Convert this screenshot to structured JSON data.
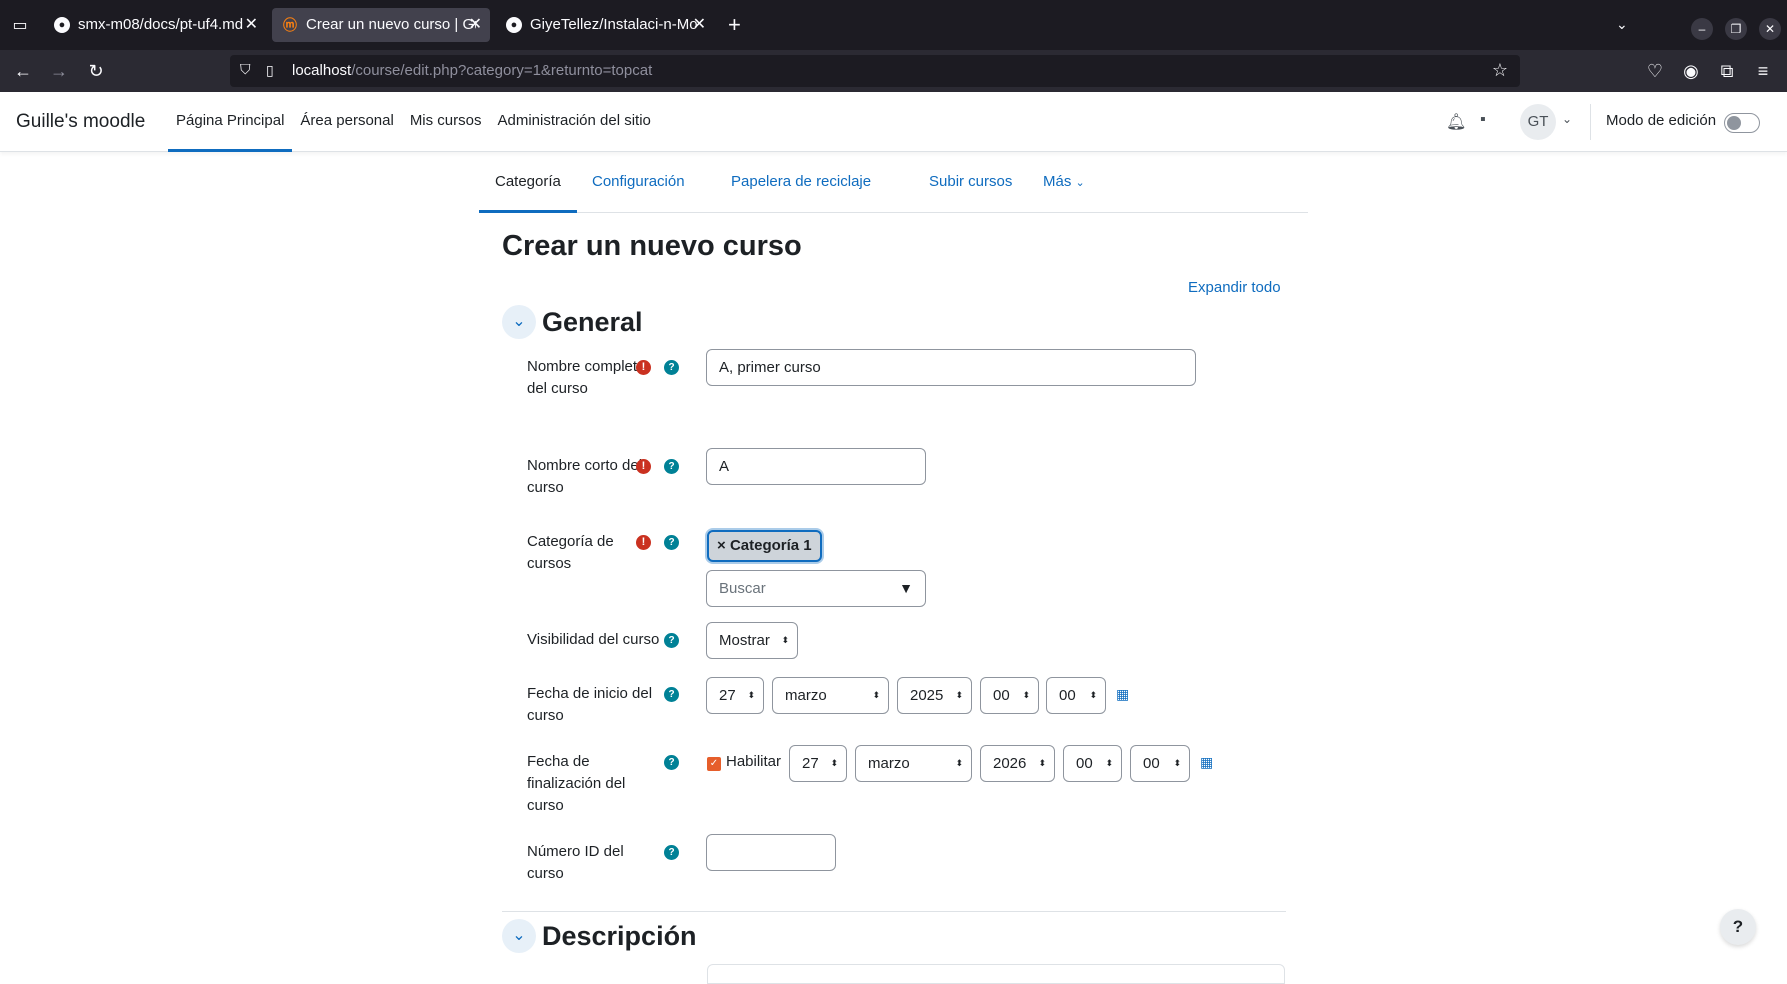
{
  "browser": {
    "tabs": [
      {
        "label": "smx-m08/docs/pt-uf4.md",
        "favicon": "github-icon",
        "active": false
      },
      {
        "label": "Crear un nuevo curso | Gu",
        "favicon": "moodle-icon",
        "active": true
      },
      {
        "label": "GiyeTellez/Instalaci-n-Mo",
        "favicon": "github-icon",
        "active": false
      }
    ],
    "url_host": "localhost",
    "url_path": "/course/edit.php?category=1&returnto=topcat"
  },
  "header": {
    "brand": "Guille's moodle",
    "nav": [
      "Página Principal",
      "Área personal",
      "Mis cursos",
      "Administración del sitio"
    ],
    "avatar_initials": "GT",
    "edit_mode_label": "Modo de edición"
  },
  "secondary_nav": [
    "Categoría",
    "Configuración",
    "Papelera de reciclaje",
    "Subir cursos",
    "Más"
  ],
  "page": {
    "title": "Crear un nuevo curso",
    "expand_all": "Expandir todo"
  },
  "general": {
    "title": "General",
    "fullname": {
      "label": "Nombre completo del curso",
      "value": "A, primer curso"
    },
    "shortname": {
      "label": "Nombre corto del curso",
      "value": "A"
    },
    "category": {
      "label": "Categoría de cursos",
      "tag": "Categoría 1",
      "search_placeholder": "Buscar"
    },
    "visibility": {
      "label": "Visibilidad del curso",
      "value": "Mostrar"
    },
    "startdate": {
      "label": "Fecha de inicio del curso",
      "day": "27",
      "month": "marzo",
      "year": "2025",
      "hour": "00",
      "minute": "00"
    },
    "enddate": {
      "label": "Fecha de finalización del curso",
      "enable_label": "Habilitar",
      "enabled": true,
      "day": "27",
      "month": "marzo",
      "year": "2026",
      "hour": "00",
      "minute": "00"
    },
    "idnumber": {
      "label": "Número ID del curso",
      "value": ""
    }
  },
  "description": {
    "title": "Descripción"
  },
  "colors": {
    "accent": "#0f6cbf",
    "required": "#ca3120",
    "help": "#008196",
    "checkbox": "#e65e2b"
  }
}
